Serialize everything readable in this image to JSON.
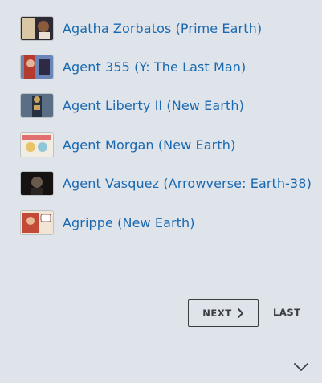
{
  "characters": [
    {
      "name": "Agatha Zorbatos (Prime Earth)",
      "thumb_colors": [
        "#2d2a33",
        "#d9c7a4",
        "#8a5a3c"
      ]
    },
    {
      "name": "Agent 355 (Y: The Last Man)",
      "thumb_colors": [
        "#b53b2e",
        "#6a85b8",
        "#2f2a44"
      ]
    },
    {
      "name": "Agent Liberty II (New Earth)",
      "thumb_colors": [
        "#5a6e86",
        "#c9a560",
        "#263040"
      ]
    },
    {
      "name": "Agent Morgan (New Earth)",
      "thumb_colors": [
        "#f2ede2",
        "#8fc7d8",
        "#e9c36a"
      ]
    },
    {
      "name": "Agent Vasquez (Arrowverse: Earth-38)",
      "thumb_colors": [
        "#2b2622",
        "#6a5a4c",
        "#151312"
      ]
    },
    {
      "name": "Agrippe (New Earth)",
      "thumb_colors": [
        "#c44a38",
        "#f1e6d6",
        "#7a2e24"
      ]
    }
  ],
  "pagination": {
    "next_label": "NEXT",
    "last_label": "LAST"
  },
  "colors": {
    "link": "#1a69b0",
    "background": "#dfe4ea",
    "button_text": "#3a3d42"
  },
  "icons": {
    "next": "chevron-right-icon",
    "collapse": "chevron-down-icon"
  }
}
